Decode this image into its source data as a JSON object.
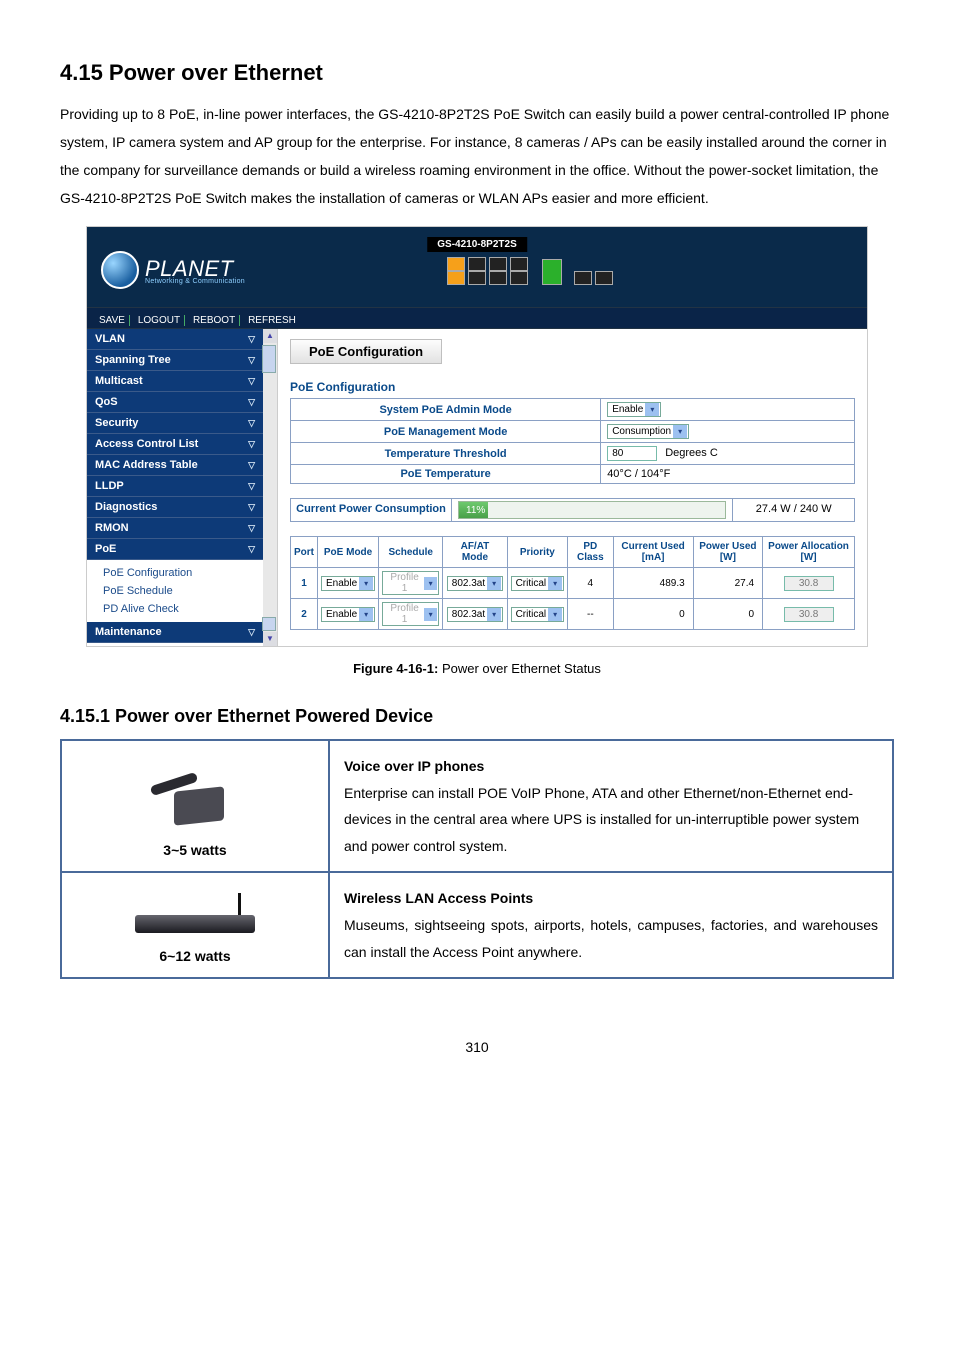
{
  "headings": {
    "h2": "4.15 Power over Ethernet",
    "h3": "4.15.1 Power over Ethernet Powered Device"
  },
  "intro": "Providing up to 8 PoE, in-line power interfaces, the GS-4210-8P2T2S PoE Switch can easily build a power central-controlled IP phone system, IP camera system and AP group for the enterprise. For instance, 8 cameras / APs can be easily installed around the corner in the company for surveillance demands or build a wireless roaming environment in the office. Without the power-socket limitation, the GS-4210-8P2T2S PoE Switch makes the installation of cameras or WLAN APs easier and more efficient.",
  "figure_caption_prefix": "Figure 4-16-1: ",
  "figure_caption": "Power over Ethernet Status",
  "page_num": "310",
  "app": {
    "brand": "PLANET",
    "brand_sub": "Networking & Communication",
    "model": "GS-4210-8P2T2S",
    "toolbar": [
      "SAVE",
      "LOGOUT",
      "REBOOT",
      "REFRESH"
    ],
    "nav": [
      "VLAN",
      "Spanning Tree",
      "Multicast",
      "QoS",
      "Security",
      "Access Control List",
      "MAC Address Table",
      "LLDP",
      "Diagnostics",
      "RMON",
      "PoE"
    ],
    "nav_sub": [
      "PoE Configuration",
      "PoE Schedule",
      "PD Alive Check"
    ],
    "nav_last": "Maintenance",
    "page_title": "PoE Configuration",
    "section_title": "PoE Configuration",
    "cfg": {
      "admin_mode_lbl": "System PoE Admin Mode",
      "admin_mode_val": "Enable",
      "mgmt_mode_lbl": "PoE Management Mode",
      "mgmt_mode_val": "Consumption",
      "temp_thresh_lbl": "Temperature Threshold",
      "temp_thresh_val": "80",
      "temp_thresh_unit": "Degrees C",
      "poe_temp_lbl": "PoE Temperature",
      "poe_temp_val": "40°C / 104°F"
    },
    "consumption": {
      "label": "Current Power Consumption",
      "percent_text": "11%",
      "percent_width": "11%",
      "value": "27.4 W / 240 W"
    },
    "port_headers": [
      "Port",
      "PoE Mode",
      "Schedule",
      "AF/AT Mode",
      "Priority",
      "PD Class",
      "Current Used [mA]",
      "Power Used [W]",
      "Power Allocation [W]"
    ],
    "port_rows": [
      {
        "port": "1",
        "poe_mode": "Enable",
        "schedule": "Profile 1",
        "afat": "802.3at",
        "priority": "Critical",
        "pd_class": "4",
        "current": "489.3",
        "power_used": "27.4",
        "power_alloc": "30.8"
      },
      {
        "port": "2",
        "poe_mode": "Enable",
        "schedule": "Profile 1",
        "afat": "802.3at",
        "priority": "Critical",
        "pd_class": "--",
        "current": "0",
        "power_used": "0",
        "power_alloc": "30.8"
      }
    ]
  },
  "pd_table": {
    "r1_watts": "3~5 watts",
    "r1_title": "Voice over IP phones",
    "r1_text": "Enterprise can install POE VoIP Phone, ATA and other Ethernet/non-Ethernet end-devices in the central area where UPS is installed for un-interruptible power system and power control system.",
    "r2_watts": "6~12 watts",
    "r2_title": "Wireless LAN Access Points",
    "r2_text": "Museums, sightseeing spots, airports, hotels, campuses, factories, and warehouses can install the Access Point anywhere."
  }
}
